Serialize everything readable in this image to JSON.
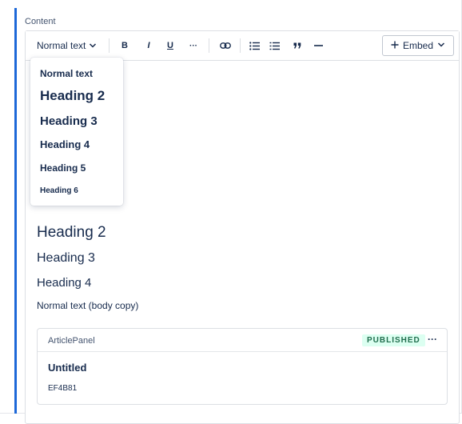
{
  "field": {
    "label": "Content"
  },
  "toolbar": {
    "style_select": "Normal text",
    "bold": "B",
    "italic": "I",
    "underline": "U",
    "more": "···",
    "embed": "Embed",
    "icons": [
      "chevron-down",
      "link",
      "bullet-list",
      "numbered-list",
      "quote",
      "divider",
      "plus"
    ]
  },
  "style_menu": {
    "items": [
      "Normal text",
      "Heading 2",
      "Heading 3",
      "Heading 4",
      "Heading 5",
      "Heading 6"
    ]
  },
  "content": {
    "heading2": "Heading 2",
    "heading3": "Heading 3",
    "heading4": "Heading 4",
    "body": "Normal text (body copy)"
  },
  "panel": {
    "title": "ArticlePanel",
    "status": "PUBLISHED",
    "more": "···",
    "name": "Untitled",
    "id": "EF4B81"
  },
  "colors": {
    "accent": "#1d68d8",
    "published_bg": "#dcfff1",
    "published_text": "#216e4e"
  }
}
